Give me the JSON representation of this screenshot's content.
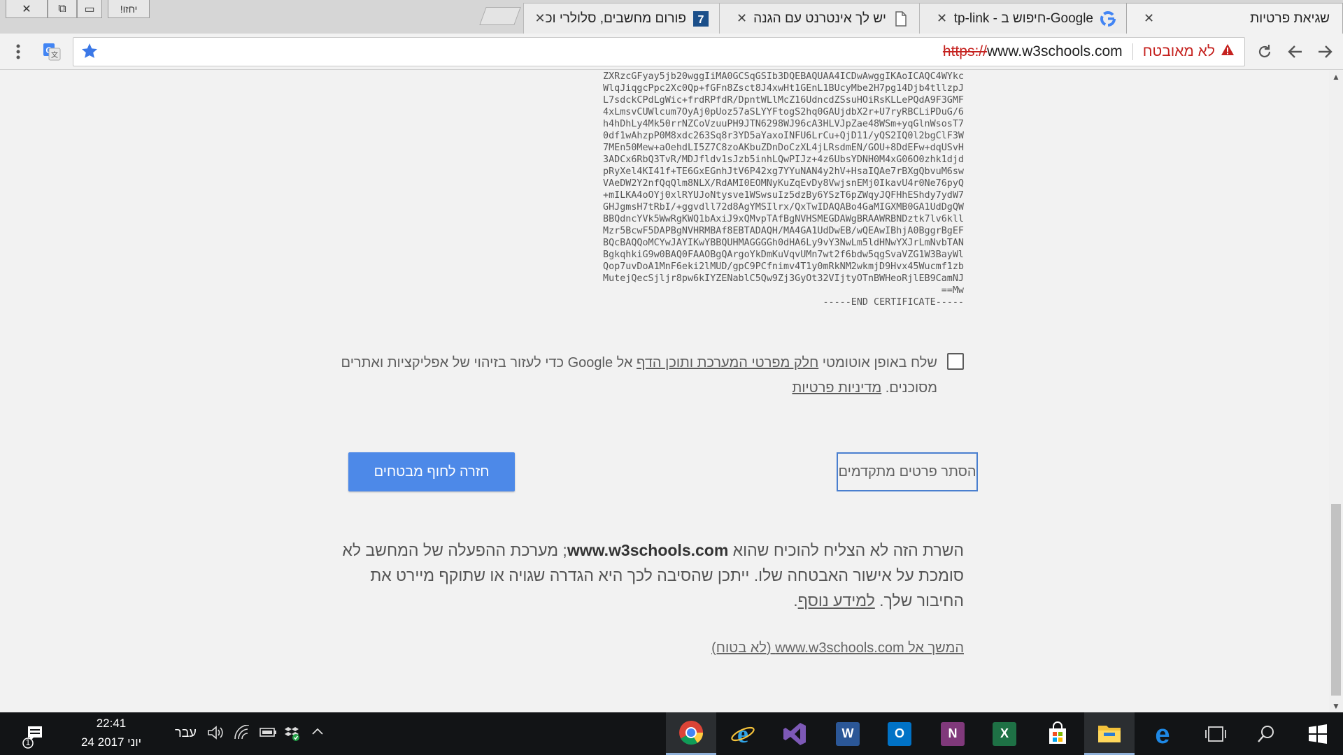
{
  "tabs": [
    {
      "title": "שגיאת פרטיות",
      "active": true
    },
    {
      "title": "tp-link - חיפוש ב-Google",
      "favicon": "google-g-icon"
    },
    {
      "title": "יש לך אינטרנט עם הגנה",
      "favicon": "document-icon"
    },
    {
      "title": "פורום מחשבים, סלולרי וכ",
      "favicon": "forum-7-icon"
    }
  ],
  "window": {
    "user_label": "יחזו!"
  },
  "toolbar": {
    "url_scheme": "https://",
    "url_host": "www.w3schools.com",
    "security_label": "לא מאובטח"
  },
  "certificate": {
    "lines": [
      "ZXRzcGFyay5jb20wggIiMA0GCSqGSIb3DQEBAQUAA4ICDwAwggIKAoICAQC4WYkc",
      "WlqJiqgcPpc2Xc0Qp+fGFn8Zsct8J4xwHt1GEnL1BUcyMbe2H7pg14Djb4tllzpJ",
      "L7sdckCPdLgWic+frdRPfdR/DpntWLlMcZ16UdncdZSsuHOiRsKLLePQdA9F3GMF",
      "4xLmsvCUWlcum7OyAj0pUoz57aSLYYFtogS2hq0GAUjdbX2r+U7ryRBCLiPDuG/6",
      "h4hDhLy4Mk50rrNZCoVzuuPH9JTN6298WJ96cA3HLVJpZae48WSm+yqGlnWsosT7",
      "0df1wAhzpP0M8xdc263Sq8r3YD5aYaxoINFU6LrCu+QjD11/yQS2IQ0l2bgClF3W",
      "7MEn50Mew+aOehdLI5Z7C8zoAKbuZDnDoCzXL4jLRsdmEN/GOU+8DdEFw+dqUSvH",
      "3ADCx6RbQ3TvR/MDJfldv1sJzb5inhLQwPIJz+4z6UbsYDNH0M4xG06O0zhk1djd",
      "pRyXel4KI41f+TE6GxEGnhJtV6P42xg7YYuNAN4y2hV+HsaIQAe7rBXgQbvuM6sw",
      "VAeDW2Y2nfQqQlm8NLX/RdAMI0EOMNyKuZqEvDy8VwjsnEMj0IkavU4r0Ne76pyQ",
      "+mILKA4oOYj0xlRYUJoNtysve1WSwsuIz5dzBy6YSzT6pZWqyJQFHhEShdy7ydW7",
      "GHJgmsH7tRbI/+ggvdll72d8AgYMSIlrx/QxTwIDAQABo4GaMIGXMB0GA1UdDgQW",
      "BBQdncYVk5WwRgKWQ1bAxiJ9xQMvpTAfBgNVHSMEGDAWgBRAAWRBNDztk7lv6kll",
      "Mzr5BcwF5DAPBgNVHRMBAf8EBTADAQH/MA4GA1UdDwEB/wQEAwIBhjA0BggrBgEF",
      "BQcBAQQoMCYwJAYIKwYBBQUHMAGGGGh0dHA6Ly9vY3NwLm5ldHNwYXJrLmNvbTAN",
      "BgkqhkiG9w0BAQ0FAAOBgQArgoYkDmKuVqvUMn7wt2f6bdw5qgSvaVZG1W3BayWl",
      "Qop7uvDoA1MnF6eki2lMUD/gpC9PCfnimv4T1y0mRkNM2wkmjD9Hvx45Wucmf1zb",
      "MutejQecSjljr8pw6kIYZENablC5Qw9Zj3GyOt32VIjtyOTnBWHeoRjlEB9CamNJ",
      "==Mw",
      "-----END CERTIFICATE-----"
    ]
  },
  "report": {
    "text_start": "שלח באופן אוטומטי ",
    "link_details": "חלק מפרטי המערכת ותוכן הדף",
    "text_mid": " אל Google כדי לעזור בזיהוי של אפליקציות ואתרים מסוכנים. ",
    "link_privacy": "מדיניות פרטיות",
    "checked": false
  },
  "buttons": {
    "advanced": "הסתר פרטים מתקדמים",
    "back": "חזרה לחוף מבטחים"
  },
  "explanation": {
    "part1": "השרת הזה לא הצליח להוכיח שהוא ",
    "host": "www.w3schools.com",
    "part2": "; מערכת ההפעלה של המחשב לא סומכת על אישור האבטחה שלו. ייתכן שהסיבה לכך היא הגדרה שגויה או שתוקף מיירט את החיבור שלך. ",
    "learn_more": "למידע נוסף",
    "end": "."
  },
  "proceed_link": "המשך אל www.w3schools.com (לא בטוח)",
  "taskbar": {
    "time": "22:41",
    "date": "24 יוני 2017",
    "language": "עבר",
    "notification_count": "1",
    "apps": [
      "start",
      "search",
      "task-view",
      "edge",
      "file-explorer",
      "store",
      "excel",
      "onenote",
      "outlook",
      "word",
      "visual-studio",
      "internet-explorer",
      "chrome"
    ]
  },
  "colors": {
    "accent_blue": "#4d89e8",
    "warning_red": "#c5221f",
    "page_bg": "#f2f2f2",
    "taskbar_bg": "#121416"
  }
}
